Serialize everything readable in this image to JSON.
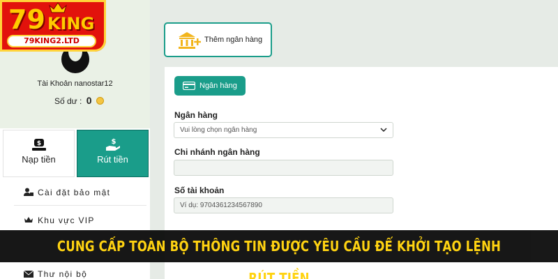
{
  "logo": {
    "brand_number": "79",
    "brand_word": "KING",
    "domain": "79KING2.LTD"
  },
  "profile": {
    "account_label": "Tài Khoản nanostar12",
    "balance_label": "Số dư :",
    "balance_value": "0"
  },
  "actions": {
    "deposit_label": "Nạp tiền",
    "withdraw_label": "Rút tiền"
  },
  "menu": {
    "items": [
      {
        "label": "Cài đặt bảo mật",
        "icon": "user-lock-icon"
      },
      {
        "label": "Khu vực VIP",
        "icon": "vip-crown-icon"
      },
      {
        "label": "Thư nội bộ",
        "icon": "mail-icon"
      }
    ]
  },
  "main": {
    "add_bank_label": "Thêm ngân hàng",
    "tab_label": "Ngân hàng",
    "fields": {
      "bank": {
        "label": "Ngân hàng",
        "value": "Vui lòng chọn ngân hàng"
      },
      "branch": {
        "label": "Chi nhánh ngân hàng",
        "value": ""
      },
      "account_no": {
        "label": "Số tài khoản",
        "placeholder": "Ví dụ:  9704361234567890"
      }
    }
  },
  "banner": {
    "text": "CUNG CẤP TOÀN BỘ THÔNG TIN ĐƯỢC YÊU CẦU ĐỂ KHỞI TẠO LỆNH RÚT TIỀN"
  },
  "colors": {
    "accent": "#1a9d8a",
    "banner_text": "#ffd000",
    "logo_red": "#e2120c"
  }
}
